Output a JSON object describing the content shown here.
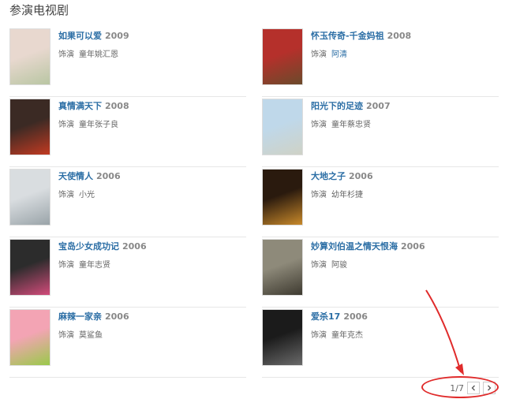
{
  "section": {
    "title": "参演电视剧"
  },
  "items": [
    {
      "title": "如果可以爱",
      "year": "2009",
      "role_prefix": "饰演",
      "role": "童年姚汇恩",
      "role_link": false,
      "poster_colors": [
        "#e8d8cf",
        "#b9c6a3"
      ]
    },
    {
      "title": "怀玉传奇-千金妈祖",
      "year": "2008",
      "role_prefix": "饰演",
      "role": "阿清",
      "role_link": true,
      "poster_colors": [
        "#b5302b",
        "#6b4a2b"
      ]
    },
    {
      "title": "真情满天下",
      "year": "2008",
      "role_prefix": "饰演",
      "role": "童年张子良",
      "role_link": false,
      "poster_colors": [
        "#3b2a24",
        "#c23a22"
      ]
    },
    {
      "title": "阳光下的足迹",
      "year": "2007",
      "role_prefix": "饰演",
      "role": "童年蔡忠贤",
      "role_link": false,
      "poster_colors": [
        "#bfd8ea",
        "#cfd2c6"
      ]
    },
    {
      "title": "天使情人",
      "year": "2006",
      "role_prefix": "饰演",
      "role": "小光",
      "role_link": false,
      "poster_colors": [
        "#d9dde0",
        "#9aa4a9"
      ]
    },
    {
      "title": "大地之子",
      "year": "2006",
      "role_prefix": "饰演",
      "role": "幼年杉捷",
      "role_link": false,
      "poster_colors": [
        "#2a1a0e",
        "#c8892a"
      ]
    },
    {
      "title": "宝岛少女成功记",
      "year": "2006",
      "role_prefix": "饰演",
      "role": "童年志贤",
      "role_link": false,
      "poster_colors": [
        "#2c2c2c",
        "#d24b7a"
      ]
    },
    {
      "title": "妙算刘伯温之情天恨海",
      "year": "2006",
      "role_prefix": "饰演",
      "role": "阿骏",
      "role_link": false,
      "poster_colors": [
        "#8e8a7a",
        "#3e3a30"
      ]
    },
    {
      "title": "麻辣一家亲",
      "year": "2006",
      "role_prefix": "饰演",
      "role": "莫鲨鱼",
      "role_link": false,
      "poster_colors": [
        "#f3a4b4",
        "#9ac94a"
      ]
    },
    {
      "title": "爱杀17",
      "year": "2006",
      "role_prefix": "饰演",
      "role": "童年克杰",
      "role_link": false,
      "poster_colors": [
        "#1b1b1b",
        "#6a6a6a"
      ]
    }
  ],
  "pager": {
    "text": "1/7"
  },
  "colors": {
    "link": "#2b6ea5",
    "annotation": "#e02b2b"
  }
}
